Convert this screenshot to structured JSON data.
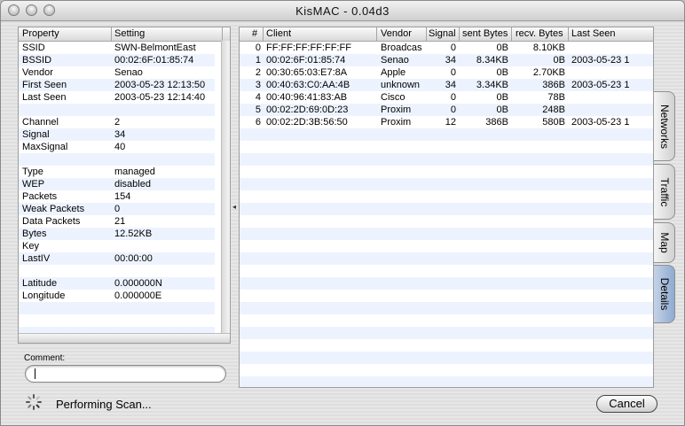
{
  "window": {
    "title": "KisMAC - 0.04d3"
  },
  "details": {
    "headers": [
      "Property",
      "Setting"
    ],
    "rows": [
      [
        "SSID",
        "SWN-BelmontEast"
      ],
      [
        "BSSID",
        "00:02:6F:01:85:74"
      ],
      [
        "Vendor",
        "Senao"
      ],
      [
        "First Seen",
        "2003-05-23 12:13:50"
      ],
      [
        "Last Seen",
        "2003-05-23 12:14:40"
      ],
      [
        "",
        ""
      ],
      [
        "Channel",
        "2"
      ],
      [
        "Signal",
        "34"
      ],
      [
        "MaxSignal",
        "40"
      ],
      [
        "",
        ""
      ],
      [
        "Type",
        "managed"
      ],
      [
        "WEP",
        "disabled"
      ],
      [
        "Packets",
        "154"
      ],
      [
        "Weak Packets",
        "0"
      ],
      [
        "Data Packets",
        "21"
      ],
      [
        "Bytes",
        "12.52KB"
      ],
      [
        "Key",
        ""
      ],
      [
        "LastIV",
        "00:00:00"
      ],
      [
        "",
        ""
      ],
      [
        "Latitude",
        "0.000000N"
      ],
      [
        "Longitude",
        "0.000000E"
      ]
    ]
  },
  "comment": {
    "label": "Comment:",
    "value": ""
  },
  "clients": {
    "headers": [
      "#",
      "Client",
      "Vendor",
      "Signal",
      "sent Bytes",
      "recv. Bytes",
      "Last Seen"
    ],
    "rows": [
      [
        "0",
        "FF:FF:FF:FF:FF:FF",
        "Broadcas",
        "0",
        "0B",
        "8.10KB",
        ""
      ],
      [
        "1",
        "00:02:6F:01:85:74",
        "Senao",
        "34",
        "8.34KB",
        "0B",
        "2003-05-23 1"
      ],
      [
        "2",
        "00:30:65:03:E7:8A",
        "Apple",
        "0",
        "0B",
        "2.70KB",
        ""
      ],
      [
        "3",
        "00:40:63:C0:AA:4B",
        "unknown",
        "34",
        "3.34KB",
        "386B",
        "2003-05-23 1"
      ],
      [
        "4",
        "00:40:96:41:83:AB",
        "Cisco",
        "0",
        "0B",
        "78B",
        ""
      ],
      [
        "5",
        "00:02:2D:69:0D:23",
        "Proxim",
        "0",
        "0B",
        "248B",
        ""
      ],
      [
        "6",
        "00:02:2D:3B:56:50",
        "Proxim",
        "12",
        "386B",
        "580B",
        "2003-05-23 1"
      ]
    ]
  },
  "tabs": [
    {
      "label": "Networks",
      "active": false
    },
    {
      "label": "Traffic",
      "active": false
    },
    {
      "label": "Map",
      "active": false
    },
    {
      "label": "Details",
      "active": true
    }
  ],
  "status": {
    "text": "Performing Scan...",
    "spinner_icon": "scan-spinner-icon"
  },
  "buttons": {
    "cancel": "Cancel"
  }
}
